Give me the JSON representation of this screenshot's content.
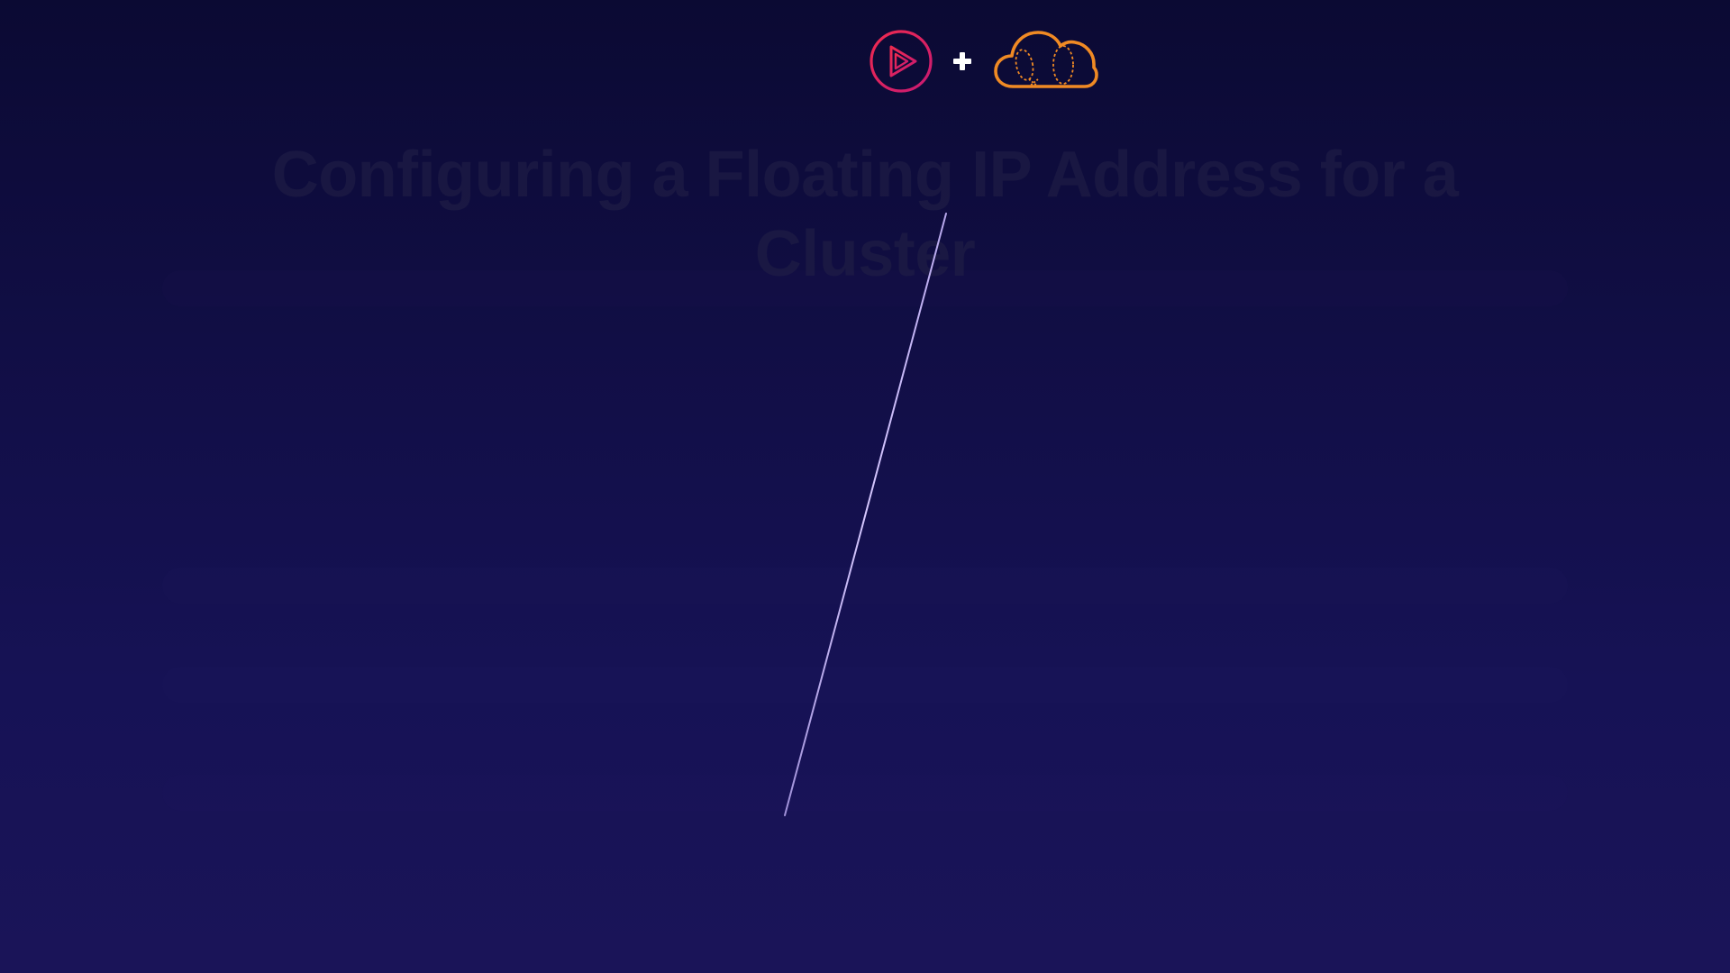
{
  "slide": {
    "title": "Configuring a Floating IP Address for a Cluster"
  },
  "logos": {
    "left_icon": "play-logo-icon",
    "separator_icon": "plus-icon",
    "right_icon": "cloud-logo-icon"
  },
  "colors": {
    "background_top": "#0b0a33",
    "background_bottom": "#1a1458",
    "play_logo_start": "#e8204f",
    "play_logo_end": "#d01b6f",
    "cloud_logo": "#f08a24",
    "plus": "#ffffff",
    "streak": "#c9b8ff",
    "title_text": "#1c1a44"
  }
}
